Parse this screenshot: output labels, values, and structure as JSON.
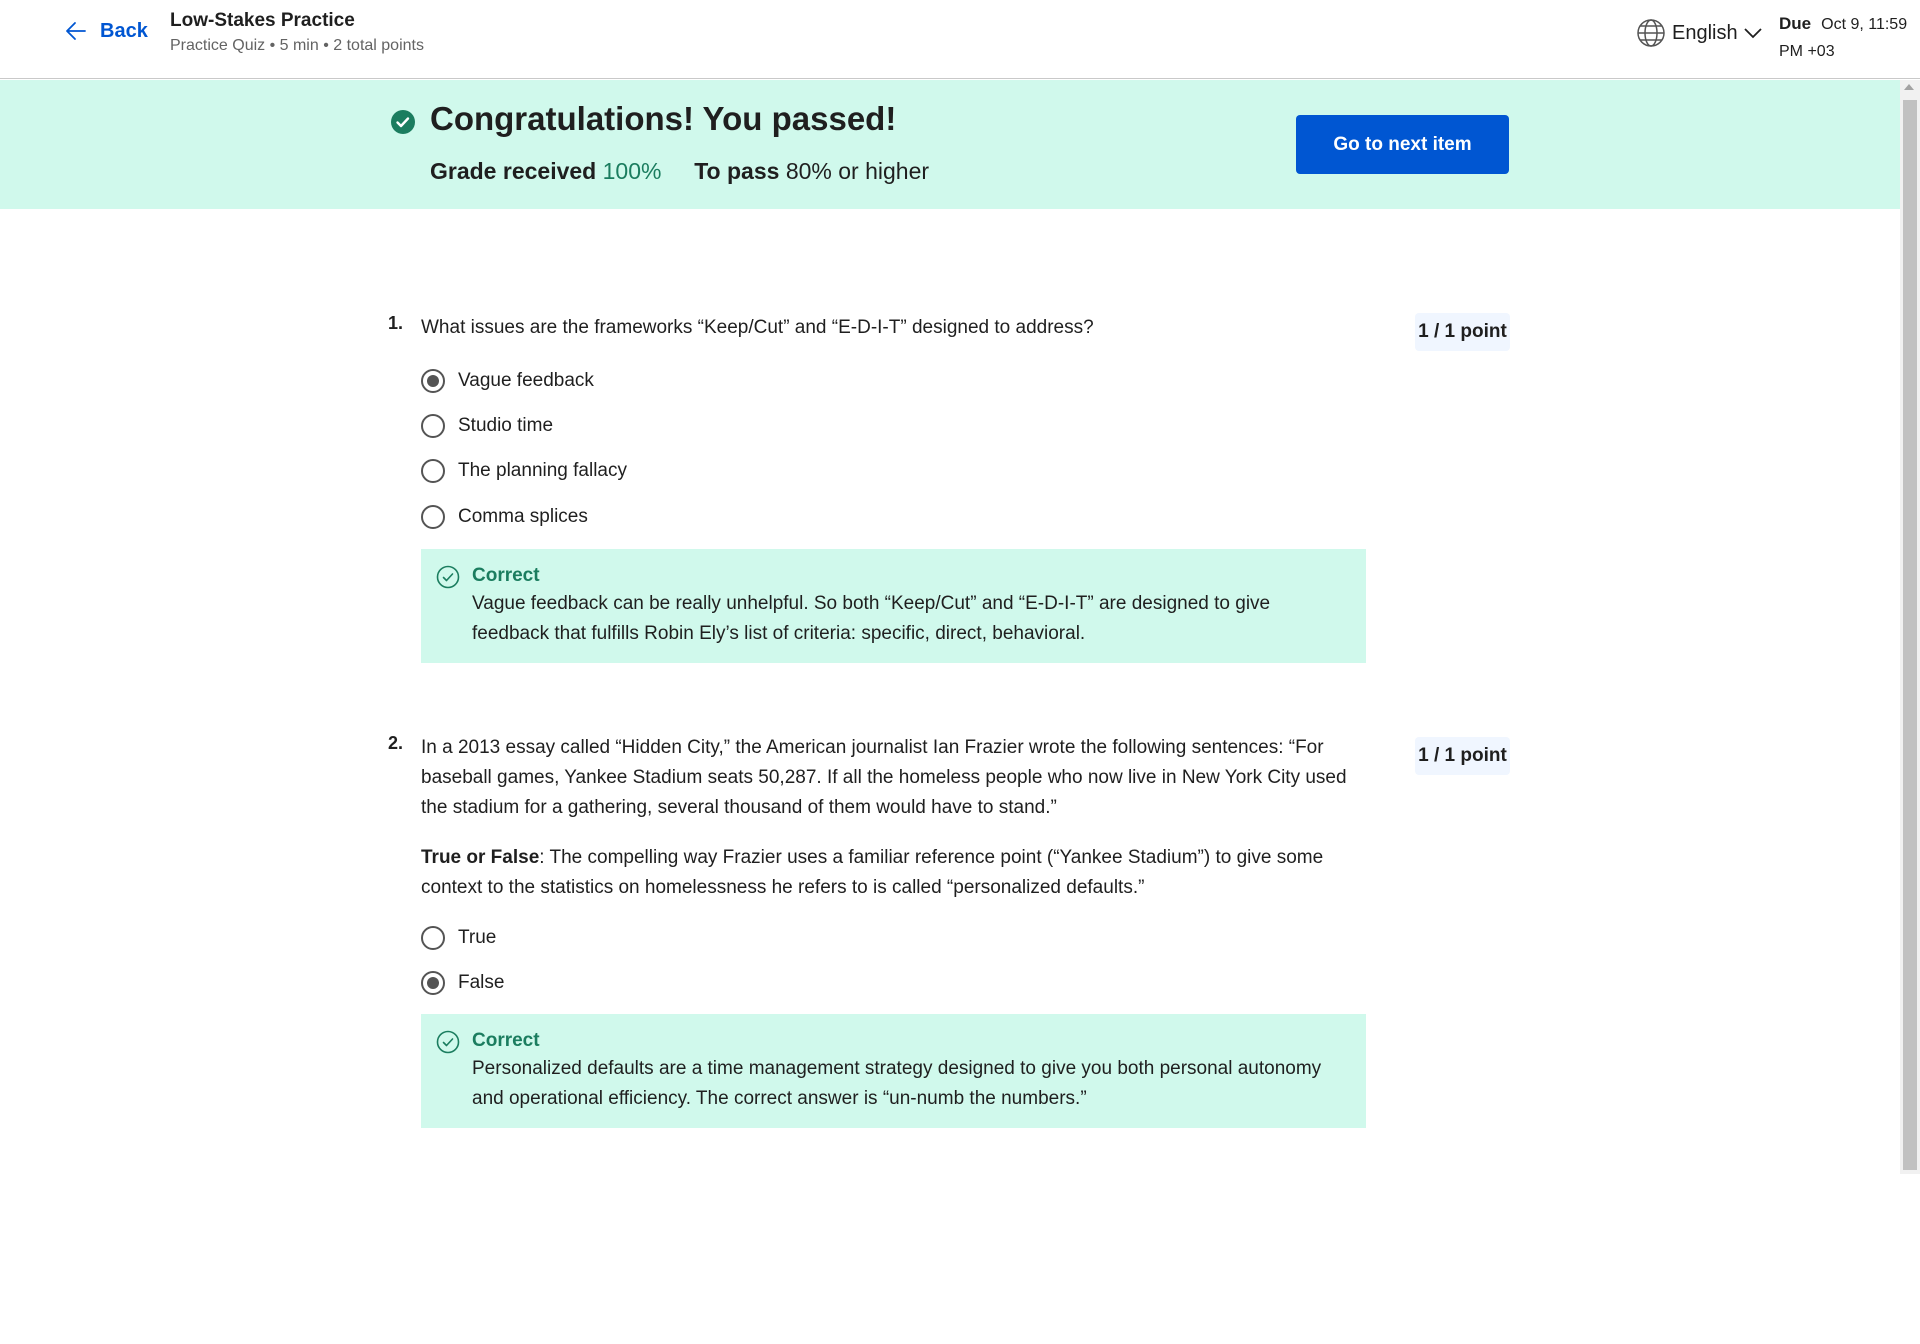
{
  "header": {
    "back_label": "Back",
    "title": "Low-Stakes Practice",
    "subtitle": "Practice Quiz • 5 min • 2 total points",
    "language": "English",
    "due_label": "Due",
    "due_line1": "Oct 9, 11:59",
    "due_line2": "PM +03"
  },
  "banner": {
    "title": "Congratulations! You passed!",
    "grade_label": "Grade received",
    "grade_value": "100%",
    "pass_label": "To pass",
    "pass_value": "80%",
    "pass_suffix": "or higher",
    "next_button": "Go to next item"
  },
  "questions": [
    {
      "number": "1.",
      "text": "What issues are the frameworks “Keep/Cut” and “E-D-I-T” designed to address?",
      "points": "1 / 1 point",
      "options": [
        {
          "label": "Vague feedback",
          "selected": true
        },
        {
          "label": "Studio time",
          "selected": false
        },
        {
          "label": "The planning fallacy",
          "selected": false
        },
        {
          "label": "Comma splices",
          "selected": false
        }
      ],
      "feedback_title": "Correct",
      "feedback_text": "Vague feedback can be really unhelpful. So both “Keep/Cut” and “E-D-I-T” are designed to give feedback that fulfills Robin Ely’s list of criteria: specific, direct, behavioral."
    },
    {
      "number": "2.",
      "text": "In a 2013 essay called “Hidden City,” the American journalist Ian Frazier wrote the following sentences: “For baseball games, Yankee Stadium seats 50,287. If all the homeless people who now live in New York City used the stadium for a gathering, several thousand of them would have to stand.”",
      "prompt_bold": "True or False",
      "prompt_text": ": The compelling way Frazier uses a familiar reference point (“Yankee Stadium”) to give some context to the statistics on homelessness he refers to is called “personalized defaults.”",
      "points": "1 / 1 point",
      "options": [
        {
          "label": "True",
          "selected": false
        },
        {
          "label": "False",
          "selected": true
        }
      ],
      "feedback_title": "Correct",
      "feedback_text": "Personalized defaults are a time management strategy designed to give you both personal autonomy and operational efficiency. The correct answer is “un-numb the numbers.”"
    }
  ]
}
